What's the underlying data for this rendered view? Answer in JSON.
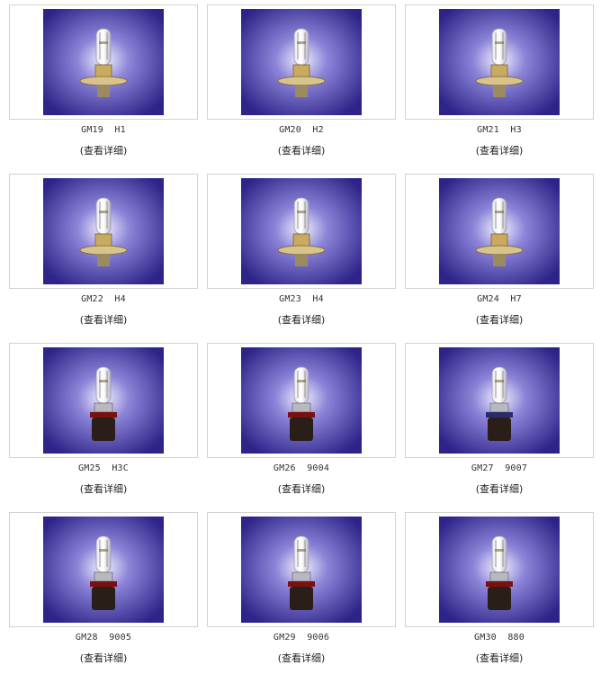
{
  "products": [
    {
      "name": "GM19  H1",
      "detail_link": "(查看详细)",
      "icon": "h1-halogen-bulb-icon"
    },
    {
      "name": "GM20  H2",
      "detail_link": "(查看详细)",
      "icon": "h2-halogen-bulb-icon"
    },
    {
      "name": "GM21  H3",
      "detail_link": "(查看详细)",
      "icon": "h3-halogen-bulb-icon"
    },
    {
      "name": "GM22  H4",
      "detail_link": "(查看详细)",
      "icon": "h4-halogen-bulb-icon"
    },
    {
      "name": "GM23  H4",
      "detail_link": "(查看详细)",
      "icon": "h4-halogen-bulb-icon"
    },
    {
      "name": "GM24  H7",
      "detail_link": "(查看详细)",
      "icon": "h7-halogen-bulb-icon"
    },
    {
      "name": "GM25  H3C",
      "detail_link": "(查看详细)",
      "icon": "h3c-halogen-bulb-icon"
    },
    {
      "name": "GM26  9004",
      "detail_link": "(查看详细)",
      "icon": "9004-halogen-bulb-icon"
    },
    {
      "name": "GM27  9007",
      "detail_link": "(查看详细)",
      "icon": "9007-halogen-bulb-icon"
    },
    {
      "name": "GM28  9005",
      "detail_link": "(查看详细)",
      "icon": "9005-halogen-bulb-icon"
    },
    {
      "name": "GM29  9006",
      "detail_link": "(查看详细)",
      "icon": "9006-halogen-bulb-icon"
    },
    {
      "name": "GM30  880",
      "detail_link": "(查看详细)",
      "icon": "880-halogen-bulb-icon"
    }
  ],
  "colors": {
    "photo_center": "#f4f2ff",
    "photo_mid": "#8b84d8",
    "photo_edge": "#2e2388",
    "frame_border": "#d2d2d2"
  }
}
